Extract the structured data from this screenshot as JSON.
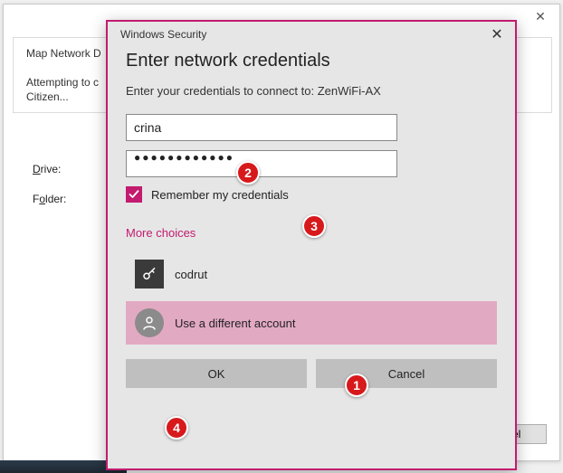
{
  "outer": {
    "title": "Map Network D",
    "status": "Attempting to c\nCitizen...",
    "drive_label": "Drive:",
    "folder_label": "Folder:",
    "cancel_label": "ancel"
  },
  "sec": {
    "window_title": "Windows Security",
    "heading": "Enter network credentials",
    "subtext": "Enter your credentials to connect to: ZenWiFi-AX",
    "username_value": "crina",
    "password_masked": "●●●●●●●●●●●●",
    "remember_label": "Remember my credentials",
    "more_choices": "More choices",
    "account1": "codrut",
    "account2": "Use a different account",
    "ok_label": "OK",
    "cancel_label": "Cancel"
  },
  "badges": {
    "b1": "1",
    "b2": "2",
    "b3": "3",
    "b4": "4"
  }
}
